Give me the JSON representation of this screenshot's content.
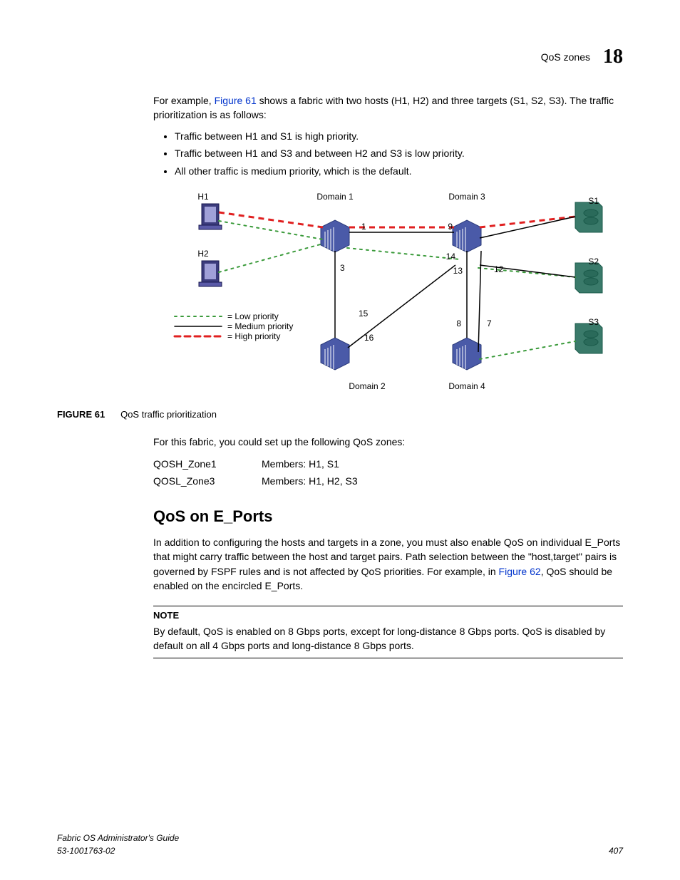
{
  "header": {
    "section": "QoS zones",
    "chapter": "18"
  },
  "intro": {
    "prefix": "For example, ",
    "link": "Figure 61",
    "suffix": " shows a fabric with two hosts (H1, H2) and three targets (S1, S2, S3). The traffic prioritization is as follows:"
  },
  "bullets": [
    "Traffic between H1 and S1 is high priority.",
    "Traffic between H1 and S3 and between H2 and S3 is low priority.",
    "All other traffic is medium priority, which is the default."
  ],
  "diagram": {
    "hosts": [
      "H1",
      "H2"
    ],
    "domains": [
      "Domain 1",
      "Domain 2",
      "Domain 3",
      "Domain 4"
    ],
    "targets": [
      "S1",
      "S2",
      "S3"
    ],
    "ports": {
      "p1": "1",
      "p3": "3",
      "p9": "9",
      "p14": "14",
      "p13": "13",
      "p12": "12",
      "p15": "15",
      "p16": "16",
      "p8": "8",
      "p7": "7"
    },
    "legend": {
      "low": "= Low priority",
      "med": "= Medium priority",
      "high": "= High priority"
    }
  },
  "figcap": {
    "num": "FIGURE 61",
    "title": "QoS traffic prioritization"
  },
  "zones_intro": "For this fabric, you could set up the following QoS zones:",
  "zones": [
    {
      "name": "QOSH_Zone1",
      "members": "Members: H1, S1"
    },
    {
      "name": "QOSL_Zone3",
      "members": "Members: H1, H2, S3"
    }
  ],
  "h2": "QoS on E_Ports",
  "eports": {
    "p1": "In addition to configuring the hosts and targets in a zone, you must also enable QoS on individual E_Ports that might carry traffic between the host and target pairs. Path selection between the \"host,target\" pairs is governed by FSPF rules and is not affected by QoS priorities. For example, in ",
    "link": "Figure 62",
    "p2": ", QoS should be enabled on the encircled E_Ports."
  },
  "note": {
    "label": "NOTE",
    "text": "By default, QoS is enabled on 8 Gbps ports, except for long-distance 8 Gbps ports. QoS is disabled by default on all 4 Gbps ports and long-distance 8 Gbps ports."
  },
  "footer": {
    "title": "Fabric OS Administrator's Guide",
    "docnum": "53-1001763-02",
    "page": "407"
  }
}
